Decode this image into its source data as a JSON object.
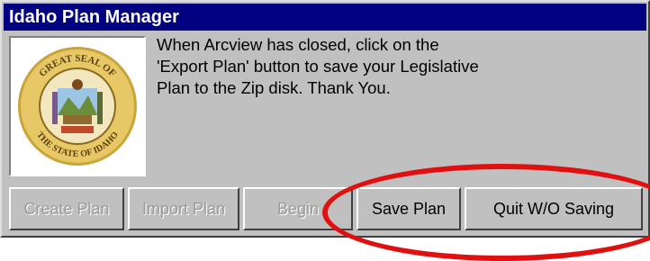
{
  "window": {
    "title": "Idaho Plan Manager"
  },
  "seal": {
    "top_text": "GREAT SEAL OF",
    "bottom_text": "THE STATE OF IDAHO"
  },
  "message": {
    "lines": [
      "When Arcview has closed, click on the",
      "'Export Plan' button to save your Legislative",
      "Plan to the Zip disk.  Thank You."
    ]
  },
  "buttons": {
    "create_plan": "Create Plan",
    "import_plan": "Import Plan",
    "begin": "Begin",
    "save_plan": "Save Plan",
    "quit_without_saving": "Quit W/O Saving"
  },
  "colors": {
    "titlebar": "#000080",
    "window_face": "#c0c0c0",
    "highlight_ellipse": "#e01010"
  }
}
